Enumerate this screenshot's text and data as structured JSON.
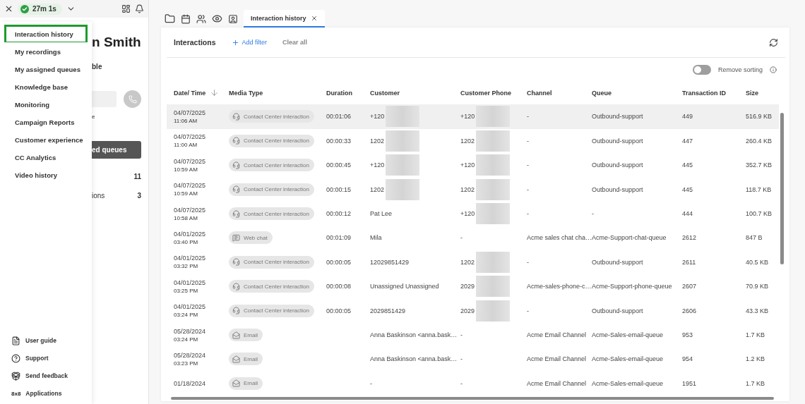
{
  "top_bar": {
    "timer": "27m 1s"
  },
  "menu": {
    "items": [
      {
        "label": "Interaction history",
        "selected": true
      },
      {
        "label": "My recordings",
        "selected": false
      },
      {
        "label": "My assigned queues",
        "selected": false
      },
      {
        "label": "Knowledge base",
        "selected": false
      },
      {
        "label": "Monitoring",
        "selected": false
      },
      {
        "label": "Campaign Reports",
        "selected": false
      },
      {
        "label": "Customer experience",
        "selected": false
      },
      {
        "label": "CC Analytics",
        "selected": false
      },
      {
        "label": "Video history",
        "selected": false
      }
    ],
    "footer": [
      {
        "kind": "guide",
        "label": "User guide"
      },
      {
        "kind": "support",
        "label": "Support"
      },
      {
        "kind": "feedback",
        "label": "Send feedback"
      },
      {
        "kind": "apps",
        "logo": "8x8",
        "label": "Applications"
      }
    ]
  },
  "profile_panel": {
    "name": "n Smith",
    "status": "ble",
    "note": "e",
    "button": "ed queues",
    "counts": [
      {
        "value": "11"
      },
      {
        "label": "ions",
        "value": "3"
      }
    ]
  },
  "tabs": [
    {
      "label": "Interaction history",
      "selected": true
    }
  ],
  "interactions": {
    "title": "Interactions",
    "add_filter": "Add filter",
    "clear_all": "Clear all",
    "remove_sorting": {
      "label": "Remove sorting",
      "on": false
    },
    "columns": [
      {
        "label": "Date/ Time",
        "sorted": true
      },
      {
        "label": "Media Type",
        "sorted": false
      },
      {
        "label": "Duration",
        "sorted": false
      },
      {
        "label": "Customer",
        "sorted": false
      },
      {
        "label": "Customer Phone",
        "sorted": false
      },
      {
        "label": "Channel",
        "sorted": false
      },
      {
        "label": "Queue",
        "sorted": false
      },
      {
        "label": "Transaction ID",
        "sorted": false
      },
      {
        "label": "Size",
        "sorted": false
      }
    ],
    "rows": [
      {
        "date": "04/07/2025",
        "time": "11:06 AM",
        "media": {
          "kind": "call",
          "label": "Contact Center interaction"
        },
        "duration": "00:01:06",
        "customer": "+120",
        "customer_blurred": true,
        "phone": "+120",
        "phone_blurred": true,
        "channel": "-",
        "queue": "Outbound-support",
        "transaction_id": "449",
        "size": "516.9 KB",
        "selected": true
      },
      {
        "date": "04/07/2025",
        "time": "11:00 AM",
        "media": {
          "kind": "call",
          "label": "Contact Center interaction"
        },
        "duration": "00:00:33",
        "customer": "1202",
        "customer_blurred": true,
        "phone": "1202",
        "phone_blurred": true,
        "channel": "-",
        "queue": "Outbound-support",
        "transaction_id": "447",
        "size": "260.4 KB",
        "selected": false
      },
      {
        "date": "04/07/2025",
        "time": "10:59 AM",
        "media": {
          "kind": "call",
          "label": "Contact Center interaction"
        },
        "duration": "00:00:45",
        "customer": "+120",
        "customer_blurred": true,
        "phone": "+120",
        "phone_blurred": true,
        "channel": "-",
        "queue": "Outbound-support",
        "transaction_id": "445",
        "size": "352.7 KB",
        "selected": false
      },
      {
        "date": "04/07/2025",
        "time": "10:59 AM",
        "media": {
          "kind": "call",
          "label": "Contact Center interaction"
        },
        "duration": "00:00:15",
        "customer": "1202",
        "customer_blurred": true,
        "phone": "1202",
        "phone_blurred": true,
        "channel": "-",
        "queue": "Outbound-support",
        "transaction_id": "445",
        "size": "118.7 KB",
        "selected": false
      },
      {
        "date": "04/07/2025",
        "time": "10:58 AM",
        "media": {
          "kind": "call",
          "label": "Contact Center interaction"
        },
        "duration": "00:00:12",
        "customer": "Pat Lee",
        "customer_blurred": false,
        "phone": "+120",
        "phone_blurred": true,
        "channel": "-",
        "queue": "-",
        "transaction_id": "444",
        "size": "100.7 KB",
        "selected": false
      },
      {
        "date": "04/01/2025",
        "time": "03:40 PM",
        "media": {
          "kind": "chat",
          "label": "Web chat"
        },
        "duration": "00:01:09",
        "customer": "Mila",
        "customer_blurred": false,
        "phone": "-",
        "phone_blurred": false,
        "channel": "Acme sales chat cha…",
        "queue": "Acme-Support-chat-queue",
        "transaction_id": "2612",
        "size": "847 B",
        "selected": false
      },
      {
        "date": "04/01/2025",
        "time": "03:32 PM",
        "media": {
          "kind": "call",
          "label": "Contact Center interaction"
        },
        "duration": "00:00:05",
        "customer": "12029851429",
        "customer_blurred": false,
        "phone": "1202",
        "phone_blurred": true,
        "channel": "-",
        "queue": "Outbound-support",
        "transaction_id": "2611",
        "size": "40.5 KB",
        "selected": false
      },
      {
        "date": "04/01/2025",
        "time": "03:25 PM",
        "media": {
          "kind": "call",
          "label": "Contact Center interaction"
        },
        "duration": "00:00:08",
        "customer": "Unassigned Unassigned",
        "customer_blurred": false,
        "phone": "2029",
        "phone_blurred": true,
        "channel": "Acme-sales-phone-c…",
        "queue": "Acme-Support-phone-queue",
        "transaction_id": "2607",
        "size": "70.9 KB",
        "selected": false
      },
      {
        "date": "04/01/2025",
        "time": "03:24 PM",
        "media": {
          "kind": "call",
          "label": "Contact Center interaction"
        },
        "duration": "00:00:05",
        "customer": "2029851429",
        "customer_blurred": false,
        "phone": "2029",
        "phone_blurred": true,
        "channel": "-",
        "queue": "Outbound-support",
        "transaction_id": "2606",
        "size": "43.3 KB",
        "selected": false
      },
      {
        "date": "05/28/2024",
        "time": "03:24 PM",
        "media": {
          "kind": "email",
          "label": "Email"
        },
        "customer": "Anna Baskinson <anna.bask…",
        "customer_blurred": false,
        "phone": "-",
        "phone_blurred": false,
        "channel": "Acme Email Channel",
        "queue": "Acme-Sales-email-queue",
        "transaction_id": "953",
        "size": "1.7 KB",
        "selected": false
      },
      {
        "date": "05/28/2024",
        "time": "03:23 PM",
        "media": {
          "kind": "email",
          "label": "Email"
        },
        "customer": "Anna Baskinson <anna.bask…",
        "customer_blurred": false,
        "phone": "-",
        "phone_blurred": false,
        "channel": "Acme Email Channel",
        "queue": "Acme-Sales-email-queue",
        "transaction_id": "954",
        "size": "1.2 KB",
        "selected": false
      },
      {
        "date": "01/18/2024",
        "media": {
          "kind": "email",
          "label": "Email"
        },
        "customer": "-",
        "customer_blurred": false,
        "phone": "-",
        "phone_blurred": false,
        "channel": "Acme Email Channel",
        "queue": "Acme-Sales-email-queue",
        "transaction_id": "1951",
        "size": "1.7 KB",
        "selected": false
      }
    ]
  }
}
